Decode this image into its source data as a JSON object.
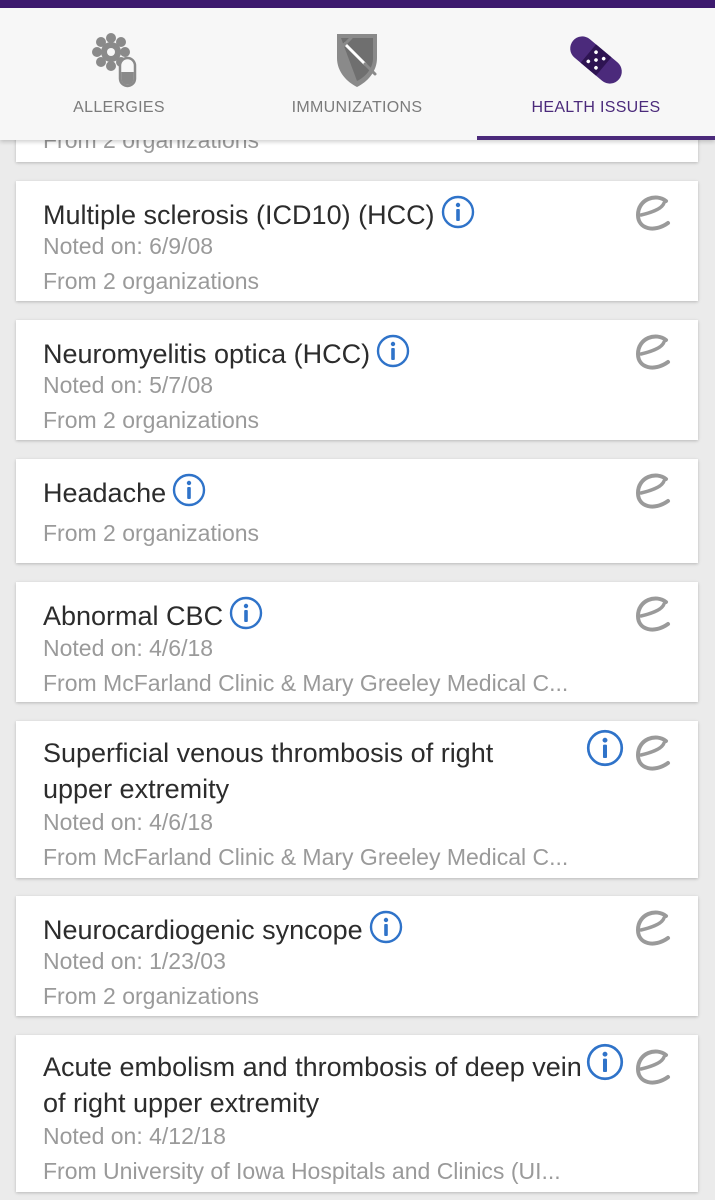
{
  "colors": {
    "accent": "#4b2a7b",
    "info": "#2f73c9",
    "topbar": "#3d1a6e"
  },
  "tabs": [
    {
      "label": "ALLERGIES",
      "icon": "allergy-pills-icon",
      "active": false
    },
    {
      "label": "IMMUNIZATIONS",
      "icon": "vaccine-shield-icon",
      "active": false
    },
    {
      "label": "HEALTH ISSUES",
      "icon": "bandage-icon",
      "active": true
    }
  ],
  "issues": [
    {
      "title": "",
      "noted": "",
      "from": "From 2 organizations"
    },
    {
      "title": "Multiple sclerosis (ICD10) (HCC)",
      "noted": "Noted on: 6/9/08",
      "from": "From 2 organizations"
    },
    {
      "title": "Neuromyelitis optica (HCC)",
      "noted": "Noted on: 5/7/08",
      "from": "From 2 organizations"
    },
    {
      "title": "Headache",
      "noted": "",
      "from": "From 2 organizations"
    },
    {
      "title": "Abnormal CBC",
      "noted": "Noted on: 4/6/18",
      "from": "From McFarland Clinic & Mary Greeley Medical C..."
    },
    {
      "title": "Superficial venous thrombosis of right upper extremity",
      "noted": "Noted on: 4/6/18",
      "from": "From McFarland Clinic & Mary Greeley Medical C..."
    },
    {
      "title": "Neurocardiogenic syncope",
      "noted": "Noted on: 1/23/03",
      "from": "From 2 organizations"
    },
    {
      "title": "Acute embolism and thrombosis of deep vein of right upper extremity",
      "noted": "Noted on: 4/12/18",
      "from": "From University of Iowa Hospitals and Clinics (UI..."
    }
  ]
}
